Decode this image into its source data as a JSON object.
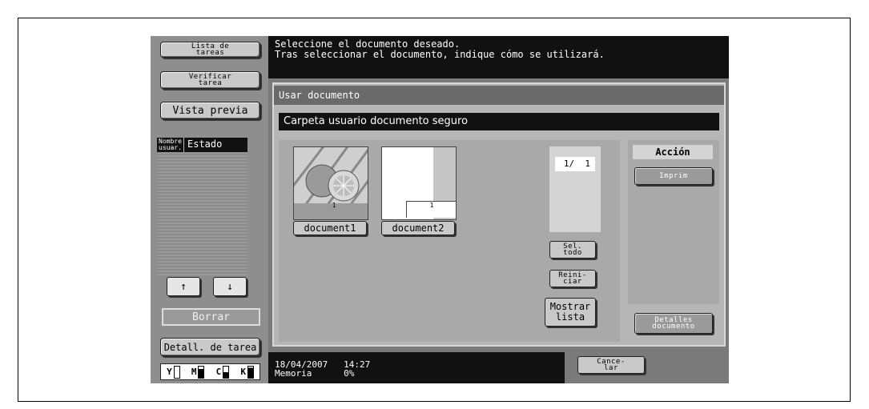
{
  "left_panel": {
    "job_list": "Lista de\ntareas",
    "check_job": "Verificar\ntarea",
    "preview": "Vista previa",
    "col_user": "Nombre\nusuar.",
    "col_status": "Estado",
    "up_arrow": "↑",
    "down_arrow": "↓",
    "delete": "Borrar",
    "job_details": "Detall. de tarea",
    "toner": [
      "Y",
      "M",
      "C",
      "K"
    ]
  },
  "message": {
    "line1": "Seleccione el documento deseado.",
    "line2": "Tras seleccionar el documento, indique cómo se utilizará."
  },
  "panel": {
    "title": "Usar documento",
    "folder": "Carpeta usuario documento seguro",
    "documents": [
      {
        "name": "document1",
        "page": "1"
      },
      {
        "name": "document2",
        "page": "1"
      }
    ],
    "page_counter": "1/  1",
    "select_all": "Sel.\ntodo",
    "reset": "Reini-\nciar",
    "show_list": "Mostrar\nlista",
    "action_header": "Acción",
    "print": "Imprim",
    "doc_details": "Detalles\ndocumento"
  },
  "status": {
    "date": "18/04/2007",
    "time": "14:27",
    "memory_label": "Memoria",
    "memory_value": "0%"
  },
  "cancel": "Cance-\nlar"
}
